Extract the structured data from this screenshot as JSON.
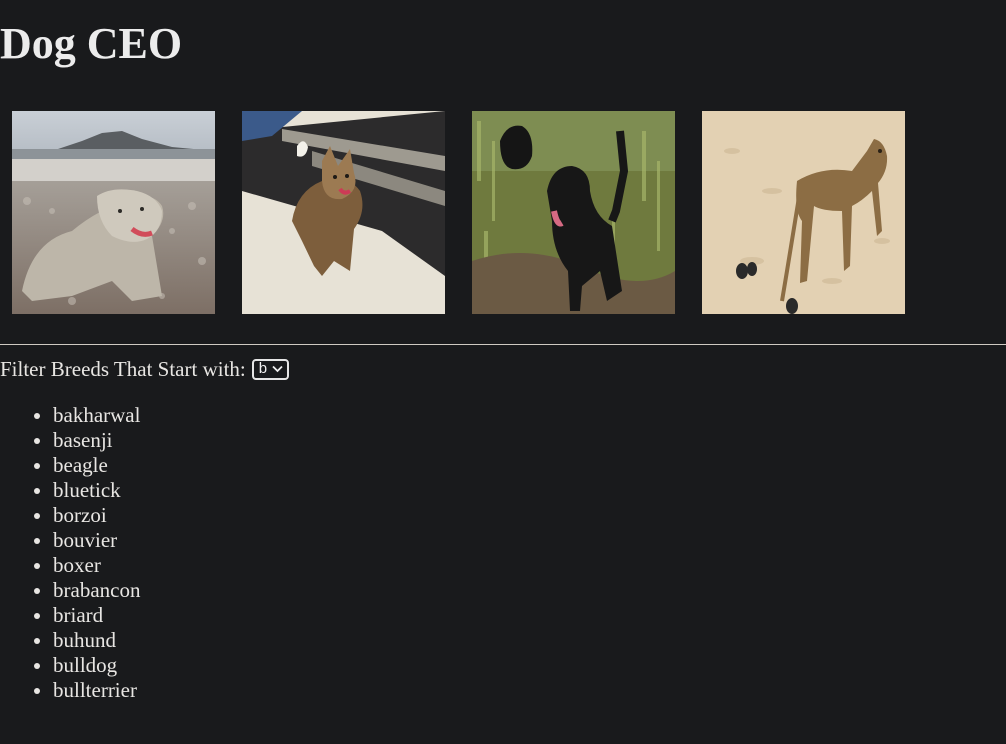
{
  "header": {
    "title": "Dog CEO"
  },
  "gallery": {
    "images": [
      {
        "name": "dog-photo-wolfhound-beach"
      },
      {
        "name": "dog-photo-yorkie-carpet"
      },
      {
        "name": "dog-photo-black-poodle-grass"
      },
      {
        "name": "dog-photo-greyhound-sand"
      }
    ]
  },
  "filter": {
    "label": "Filter Breeds That Start with:",
    "selected": "b"
  },
  "breeds": [
    "bakharwal",
    "basenji",
    "beagle",
    "bluetick",
    "borzoi",
    "bouvier",
    "boxer",
    "brabancon",
    "briard",
    "buhund",
    "bulldog",
    "bullterrier"
  ],
  "colors": {
    "background": "#191a1c",
    "text": "#e8e6e3"
  }
}
